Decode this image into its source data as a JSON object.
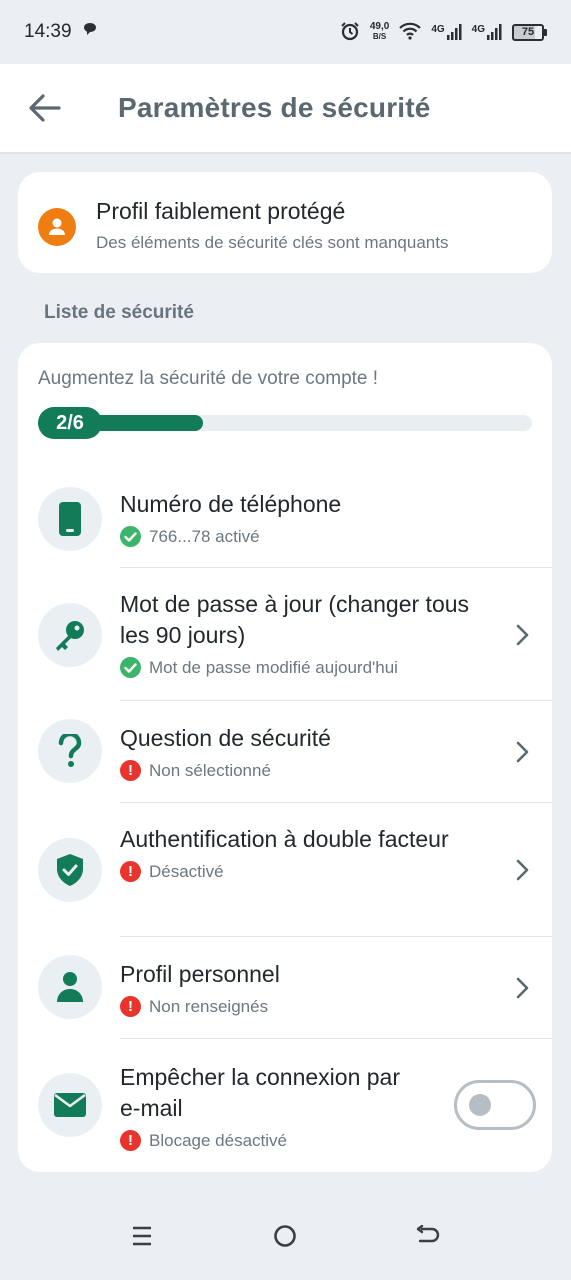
{
  "status_bar": {
    "time": "14:39",
    "speed_value": "49,0",
    "speed_unit": "B/S",
    "signal_1": "4G",
    "signal_2": "4G",
    "battery": "75"
  },
  "header": {
    "title": "Paramètres de sécurité"
  },
  "profile_card": {
    "title": "Profil faiblement protégé",
    "subtitle": "Des éléments de sécurité clés sont manquants",
    "accent_color": "#f07d12"
  },
  "section_title": "Liste de sécurité",
  "checklist": {
    "intro": "Augmentez la sécurité de votre compte !",
    "progress_label": "2/6",
    "progress_fraction": 0.333,
    "accent_color": "#127b57",
    "items": [
      {
        "title": "Numéro de téléphone",
        "status": "766...78 activé",
        "state": "ok",
        "icon": "phone-icon"
      },
      {
        "title": "Mot de passe à jour (changer tous les 90 jours)",
        "status": "Mot de passe modifié aujourd'hui",
        "state": "ok",
        "icon": "key-icon"
      },
      {
        "title": "Question de sécurité",
        "status": "Non sélectionné",
        "state": "bad",
        "icon": "question-icon"
      },
      {
        "title": "Authentification à double facteur",
        "status": "Désactivé",
        "state": "bad",
        "icon": "shield-check-icon"
      },
      {
        "title": "Profil personnel",
        "status": "Non renseignés",
        "state": "bad",
        "icon": "person-icon"
      },
      {
        "title": "Empêcher la connexion par e-mail",
        "status": "Blocage désactivé",
        "state": "bad",
        "icon": "mail-icon"
      }
    ]
  },
  "status_marks": {
    "ok_icon": "check-circle-icon",
    "bad_icon": "exclamation-circle-icon",
    "bad_glyph": "!"
  },
  "nav_bar": {
    "menu_icon": "menu-icon",
    "home_icon": "home-circle-icon",
    "back_icon": "back-arrow-icon"
  }
}
